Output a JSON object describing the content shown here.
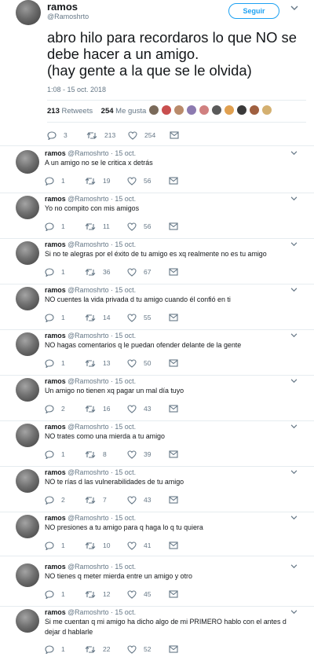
{
  "main_tweet": {
    "name": "ramos",
    "handle": "@Ramoshrto",
    "follow_label": "Seguir",
    "text_lines": [
      "abro hilo para recordaros lo que NO se",
      "debe hacer a un amigo.",
      "(hay gente a la que se le olvida)"
    ],
    "timestamp": "1:08 - 15 oct. 2018",
    "retweets_count": "213",
    "retweets_label": "Retweets",
    "likes_count": "254",
    "likes_label": "Me gusta",
    "liker_avatar_colors": [
      "#7a6a5a",
      "#c94f4f",
      "#b98a6a",
      "#8c7ab0",
      "#d08080",
      "#5a5a5a",
      "#e0a050",
      "#3a3a3a",
      "#a06040",
      "#d4b070"
    ],
    "actions": {
      "replies": "3",
      "retweets": "213",
      "likes": "254"
    }
  },
  "colors": {
    "accent": "#1da1f2",
    "secondary_text": "#657786",
    "divider": "#e6ecf0"
  },
  "icons": [
    "reply-icon",
    "retweet-icon",
    "heart-icon",
    "envelope-icon",
    "chevron-down-icon"
  ],
  "replies": [
    {
      "name": "ramos",
      "meta": "@Ramoshrto · 15 oct.",
      "text": "A un amigo no se le critica x detrás",
      "replies": "1",
      "retweets": "19",
      "likes": "56"
    },
    {
      "name": "ramos",
      "meta": "@Ramoshrto · 15 oct.",
      "text": "Yo no compito con mis amigos",
      "replies": "1",
      "retweets": "11",
      "likes": "56"
    },
    {
      "name": "ramos",
      "meta": "@Ramoshrto · 15 oct.",
      "text": "Si no te alegras por el éxito de tu amigo es xq realmente no es tu amigo",
      "replies": "1",
      "retweets": "36",
      "likes": "67"
    },
    {
      "name": "ramos",
      "meta": "@Ramoshrto · 15 oct.",
      "text": "NO cuentes la vida privada d tu amigo cuando él confió en ti",
      "replies": "1",
      "retweets": "14",
      "likes": "55"
    },
    {
      "name": "ramos",
      "meta": "@Ramoshrto · 15 oct.",
      "text": "NO hagas comentarios q le puedan ofender delante de la gente",
      "replies": "1",
      "retweets": "13",
      "likes": "50"
    },
    {
      "name": "ramos",
      "meta": "@Ramoshrto · 15 oct.",
      "text": "Un amigo no tienen xq pagar un mal día tuyo",
      "replies": "2",
      "retweets": "16",
      "likes": "43"
    },
    {
      "name": "ramos",
      "meta": "@Ramoshrto · 15 oct.",
      "text": "NO trates como una mierda a tu amigo",
      "replies": "1",
      "retweets": "8",
      "likes": "39"
    },
    {
      "name": "ramos",
      "meta": "@Ramoshrto · 15 oct.",
      "text": "NO te rías d las vulnerabilidades de tu amigo",
      "replies": "2",
      "retweets": "7",
      "likes": "43"
    },
    {
      "name": "ramos",
      "meta": "@Ramoshrto · 15 oct.",
      "text": "NO presiones a tu amigo para q haga lo q tu quiera",
      "replies": "1",
      "retweets": "10",
      "likes": "41"
    },
    {
      "name": "ramos",
      "meta": "@Ramoshrto · 15 oct.",
      "text": "NO tienes q meter mierda entre un amigo y otro",
      "replies": "1",
      "retweets": "12",
      "likes": "45"
    },
    {
      "name": "ramos",
      "meta": "@Ramoshrto · 15 oct.",
      "text": "Si me cuentan q mi amigo ha dicho algo de mi PRIMERO hablo con el antes d dejar d hablarle",
      "replies": "1",
      "retweets": "22",
      "likes": "52"
    }
  ]
}
